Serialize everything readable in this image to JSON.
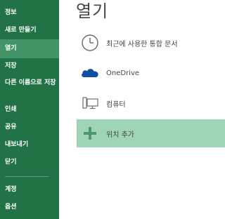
{
  "sidebar": {
    "items": [
      {
        "label": "정보"
      },
      {
        "label": "새로 만들기"
      },
      {
        "label": "열기",
        "selected": true
      },
      {
        "label": "저장"
      },
      {
        "label": "다른 이름으로 저장"
      },
      {
        "label": "인쇄"
      },
      {
        "label": "공유"
      },
      {
        "label": "내보내기"
      },
      {
        "label": "닫기"
      },
      {
        "label": "계정"
      },
      {
        "label": "옵션"
      }
    ]
  },
  "main": {
    "title": "열기",
    "locations": [
      {
        "label": "최근에 사용한 통합 문서",
        "icon": "clock-icon"
      },
      {
        "label": "OneDrive",
        "icon": "cloud-icon"
      },
      {
        "label": "컴퓨터",
        "icon": "computer-icon"
      },
      {
        "label": "위치 추가",
        "icon": "plus-icon",
        "highlighted": true
      }
    ]
  },
  "colors": {
    "sidebar_bg": "#217346",
    "sidebar_selected": "#439467",
    "highlight_bg": "#9fd5b7",
    "onedrive_blue": "#0f4ea1",
    "plus_green": "#4c9a6a"
  }
}
